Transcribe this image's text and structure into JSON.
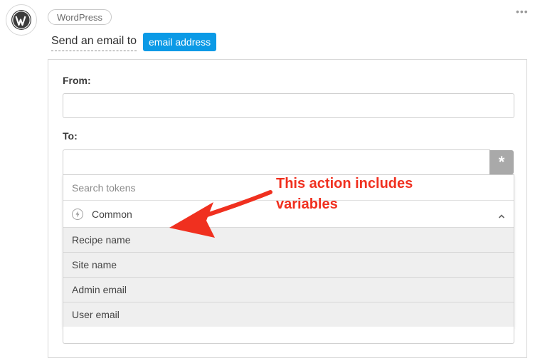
{
  "header": {
    "integration_badge": "WordPress",
    "more_menu": "•••",
    "sentence_text": "Send an email to",
    "field_tag": "email address"
  },
  "form": {
    "from_label": "From:",
    "from_value": "",
    "to_label": "To:",
    "to_value": "",
    "token_button_symbol": "*"
  },
  "token_dropdown": {
    "search_placeholder": "Search tokens",
    "group_label": "Common",
    "items": [
      {
        "label": "Recipe name"
      },
      {
        "label": "Site name"
      },
      {
        "label": "Admin email"
      },
      {
        "label": "User email"
      }
    ]
  },
  "annotation": {
    "line1": "This action includes",
    "line2": "variables",
    "color": "#f0301f"
  },
  "icons": {
    "logo": "wordpress-logo-icon",
    "group": "bolt-icon",
    "chevron": "chevron-up-icon"
  },
  "colors": {
    "accent": "#0b9ae6",
    "token_button": "#a9a9a9"
  }
}
